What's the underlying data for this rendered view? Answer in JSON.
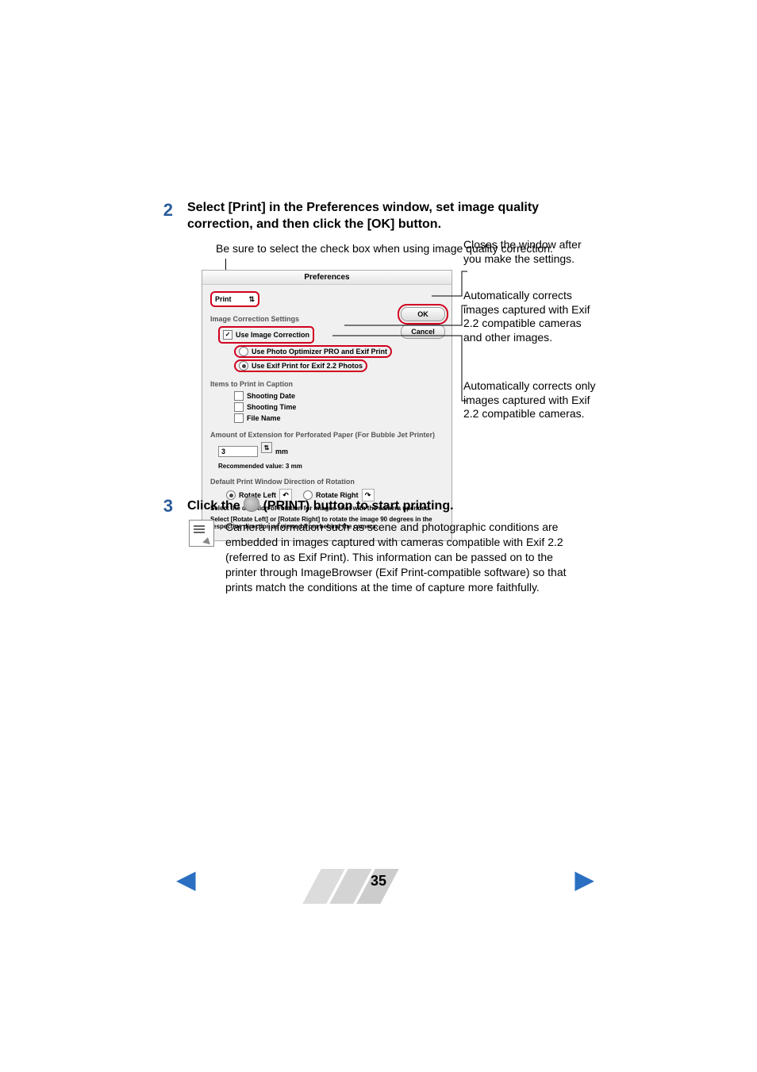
{
  "step2": {
    "num": "2",
    "title": "Select [Print] in the Preferences window, set image quality correction, and then click the [OK] button."
  },
  "step3": {
    "num": "3",
    "title_pre": "Click the ",
    "title_post": " (PRINT) button to start printing."
  },
  "hint_top": "Be sure to select the check box when using image quality correction.",
  "callout_close": "Closes the window after you make the settings.",
  "callout_opt1": "Automatically corrects images captured with Exif 2.2 compatible cameras and other images.",
  "callout_opt2": "Automatically corrects only images captured with Exif 2.2 compatible cameras.",
  "dialog": {
    "title": "Preferences",
    "dropdown": "Print",
    "ok": "OK",
    "cancel": "Cancel",
    "section_imgcorr": "Image Correction Settings",
    "chk_use_imgcorr": "Use Image Correction",
    "radio_opt1": "Use Photo Optimizer PRO and Exif Print",
    "radio_opt2": "Use Exif Print for Exif 2.2 Photos",
    "section_caption": "Items to Print in Caption",
    "chk_date": "Shooting Date",
    "chk_time": "Shooting Time",
    "chk_filename": "File Name",
    "section_perf": "Amount of Extension for Perforated Paper (For Bubble Jet Printer)",
    "perf_value": "3",
    "perf_unit": "mm",
    "perf_note": "Recommended value: 3 mm",
    "section_rotate": "Default Print Window Direction of Rotation",
    "rotate_left": "Rotate Left",
    "rotate_right": "Rotate Right",
    "rotate_note1": "Select the direction of rotation for images shot with the camera upended.",
    "rotate_note2": "Select [Rotate Left] or [Rotate Right] to rotate the image 90 degrees in the respective direction as viewed from behind the camera."
  },
  "info_text": "Camera information such as scene and photographic conditions are embedded in images captured with cameras compatible with Exif 2.2 (referred to as Exif Print). This information can be passed on to the printer through ImageBrowser (Exif Print-compatible software) so that prints match the conditions at the time of capture more faithfully.",
  "page_number": "35"
}
